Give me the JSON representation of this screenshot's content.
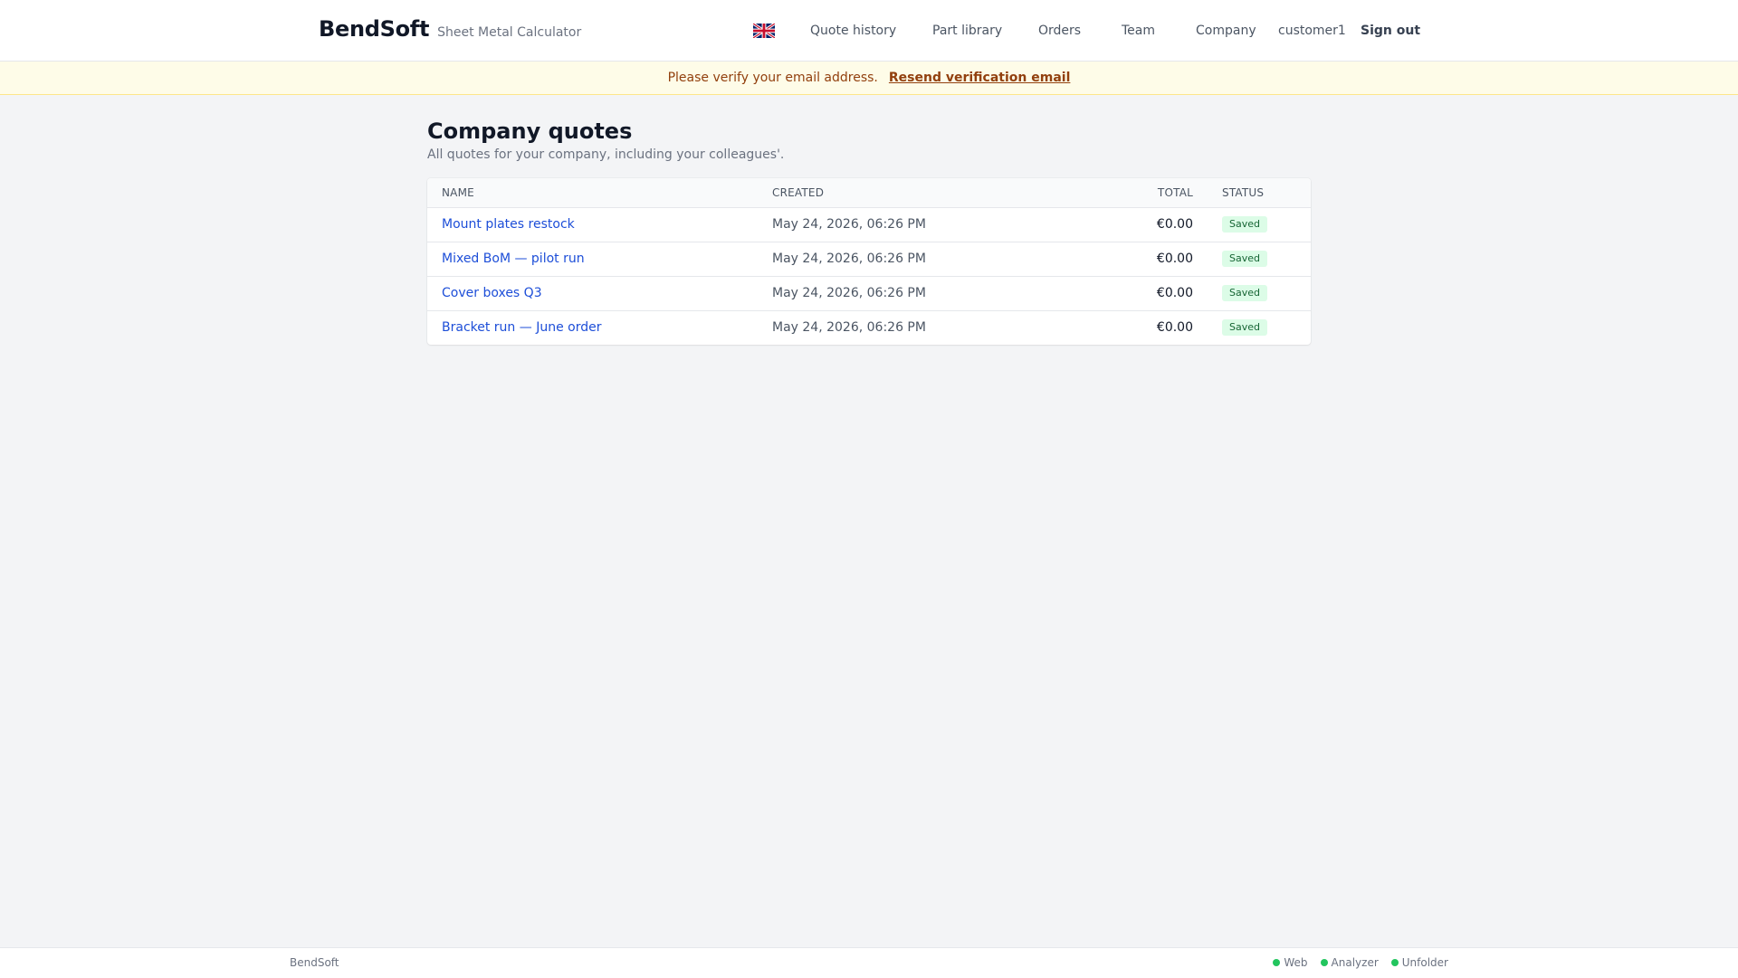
{
  "header": {
    "brand": "BendSoft",
    "subtitle": "Sheet Metal Calculator",
    "language_icon": "uk-flag-icon",
    "nav": [
      {
        "label": "Quote history"
      },
      {
        "label": "Part library"
      },
      {
        "label": "Orders"
      },
      {
        "label": "Team"
      },
      {
        "label": "Company"
      }
    ],
    "username": "customer1",
    "sign_out": "Sign out"
  },
  "banner": {
    "message": "Please verify your email address.",
    "link": "Resend verification email"
  },
  "main": {
    "title": "Company quotes",
    "subtitle": "All quotes for your company, including your colleagues'.",
    "table": {
      "columns": [
        "Name",
        "Created",
        "Total",
        "Status"
      ],
      "rows": [
        {
          "name": "Mount plates restock",
          "created": "May 24, 2026, 06:26 PM",
          "total": "€0.00",
          "status": "Saved"
        },
        {
          "name": "Mixed BoM — pilot run",
          "created": "May 24, 2026, 06:26 PM",
          "total": "€0.00",
          "status": "Saved"
        },
        {
          "name": "Cover boxes Q3",
          "created": "May 24, 2026, 06:26 PM",
          "total": "€0.00",
          "status": "Saved"
        },
        {
          "name": "Bracket run — June order",
          "created": "May 24, 2026, 06:26 PM",
          "total": "€0.00",
          "status": "Saved"
        }
      ]
    }
  },
  "footer": {
    "brand": "BendSoft",
    "services": [
      {
        "label": "Web",
        "color": "#22c55e"
      },
      {
        "label": "Analyzer",
        "color": "#22c55e"
      },
      {
        "label": "Unfolder",
        "color": "#22c55e"
      }
    ]
  },
  "colors": {
    "link": "#1d4ed8",
    "banner_bg": "#fefce8",
    "banner_text": "#92400e",
    "badge_bg": "#dcfce7",
    "badge_text": "#166534",
    "status_ok": "#22c55e"
  }
}
